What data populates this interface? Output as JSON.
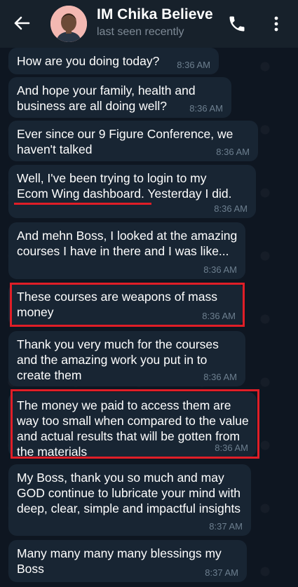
{
  "header": {
    "title": "IM Chika Believe",
    "status": "last seen recently"
  },
  "icons": {
    "back": "arrow-left-icon",
    "call": "phone-icon",
    "menu": "more-vertical-icon"
  },
  "colors": {
    "header_bg": "#17212b",
    "chat_bg": "#0e1621",
    "bubble_bg": "#182533",
    "highlight": "#e01e27"
  },
  "messages": [
    {
      "text": "How are you doing today?",
      "time": "8:36 AM"
    },
    {
      "text": "And hope your family, health and business are all doing well?",
      "time": "8:36 AM"
    },
    {
      "text": "Ever since our 9 Figure Conference, we haven't talked",
      "time": "8:36 AM"
    },
    {
      "text_a": "Well, I've been trying to login to my",
      "text_b": "Ecom Wing dashboard",
      "text_c": ". Yesterday I did.",
      "time": "8:36 AM"
    },
    {
      "text": "And mehn Boss, I looked at the amazing courses I have in there and I was like...",
      "time": "8:36 AM"
    },
    {
      "text": "These courses are weapons of mass money",
      "time": "8:36 AM"
    },
    {
      "text": "Thank you very much for the courses and the amazing work you put in to create them",
      "time": "8:36 AM"
    },
    {
      "text": "The money we paid to access them are way too small when compared to the value and actual results that will be gotten from the materials",
      "time": "8:36 AM"
    },
    {
      "text": "My Boss, thank you so much and may GOD continue to lubricate your mind with deep, clear, simple and impactful insights",
      "time": "8:37 AM"
    },
    {
      "text": "Many many many many blessings my Boss",
      "time": "8:37 AM"
    }
  ]
}
